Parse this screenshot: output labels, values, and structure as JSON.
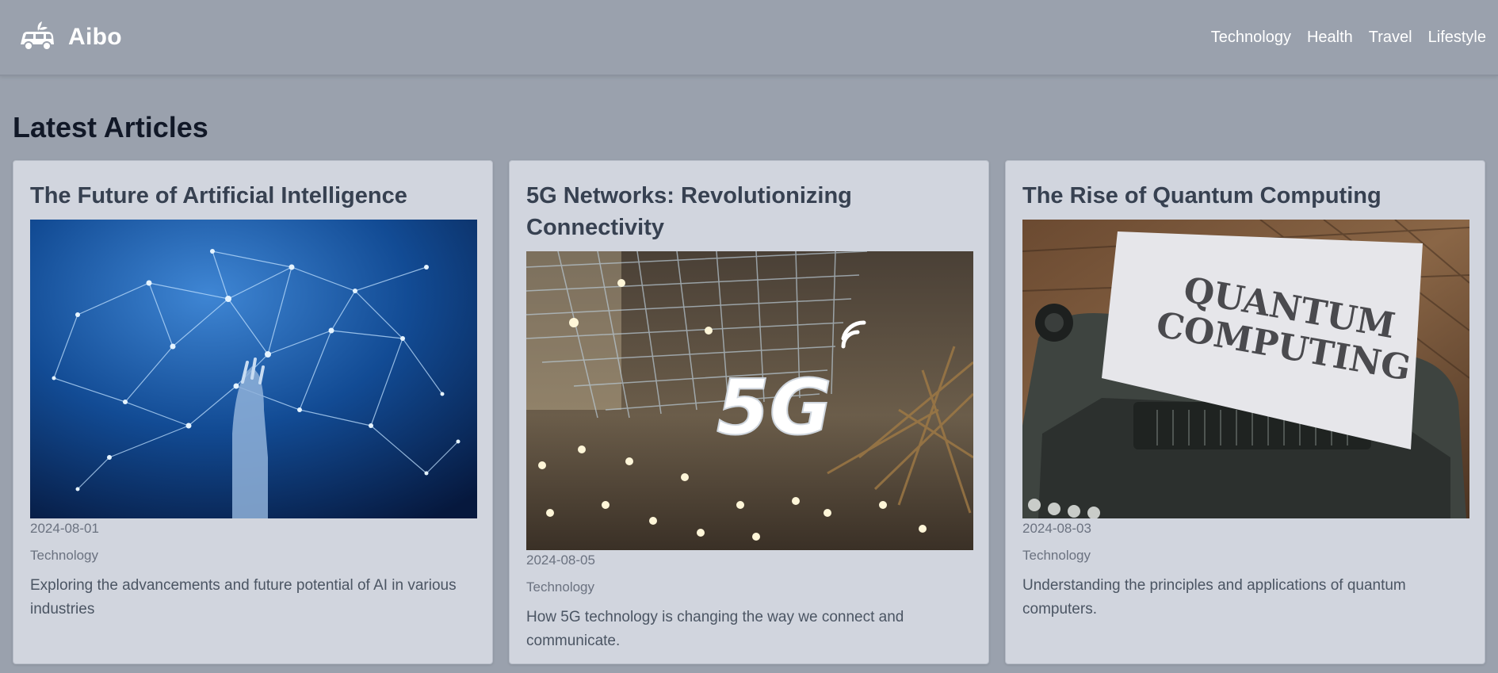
{
  "brand": {
    "name": "Aibo",
    "logo_icon": "van-logo-icon"
  },
  "nav": {
    "links": [
      {
        "label": "Technology"
      },
      {
        "label": "Health"
      },
      {
        "label": "Travel"
      },
      {
        "label": "Lifestyle"
      }
    ]
  },
  "main": {
    "section_title": "Latest Articles",
    "articles": [
      {
        "title": "The Future of Artificial Intelligence",
        "image": "ai-network-hand-image",
        "date": "2024-08-01",
        "category": "Technology",
        "description": "Exploring the advancements and future potential of AI in various industries"
      },
      {
        "title": "5G Networks: Revolutionizing Connectivity",
        "image": "5g-sign-image",
        "image_text": "5G",
        "date": "2024-08-05",
        "category": "Technology",
        "description": "How 5G technology is changing the way we connect and communicate."
      },
      {
        "title": "The Rise of Quantum Computing",
        "image": "typewriter-quantum-computing-image",
        "image_text_line1": "QUANTUM",
        "image_text_line2": "COMPUTING",
        "date": "2024-08-03",
        "category": "Technology",
        "description": "Understanding the principles and applications of quantum computers."
      }
    ]
  },
  "colors": {
    "page_background": "#9aa1ad",
    "card_background": "#d1d5de",
    "nav_text": "#ffffff",
    "title_text": "#111827"
  }
}
